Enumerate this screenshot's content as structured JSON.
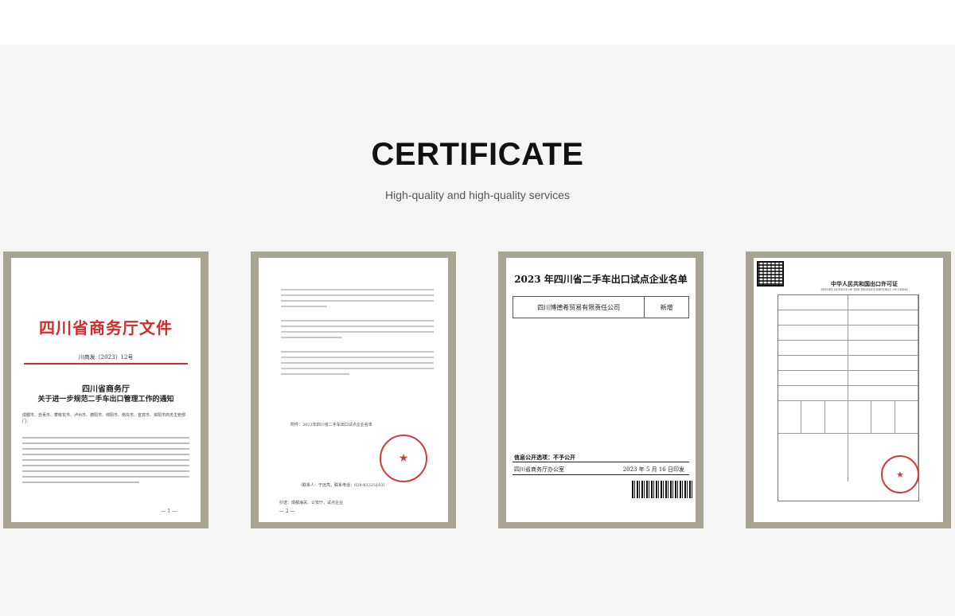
{
  "section": {
    "title": "CERTIFICATE",
    "subtitle": "High-quality and high-quality services"
  },
  "doc1": {
    "header": "四川省商务厅文件",
    "docnum": "川商发〔2023〕12号",
    "org": "四川省商务厅",
    "notice_title": "关于进一步规范二手车出口管理工作的通知",
    "recipients": "成都市、自贡市、攀枝花市、泸州市、德阳市、绵阳市、南充市、宜宾市、资阳市商务主管部门：",
    "page": "— 1 —"
  },
  "doc2": {
    "contact": "（联系人：于远亮，联系电话：028-83225103）",
    "cc": "抄送：成都海关、公安厅，试点企业",
    "attachment": "附件：2023年四川省二手车出口试点企业名单",
    "page": "— 2 —"
  },
  "doc3": {
    "title": "2023 年四川省二手车出口试点企业名单",
    "company": "四川博德希贸易有限责任公司",
    "status": "新增",
    "disclosure": "信息公开选项：不予公开",
    "office": "四川省商务厅办公室",
    "date": "2023 年 5 月 16 日印发"
  },
  "doc4": {
    "title_cn": "中华人民共和国出口许可证",
    "title_en": "EXPORT LICENCE OF THE PEOPLE'S REPUBLIC OF CHINA"
  },
  "colors": {
    "stamp_red": "#d23b3b",
    "frame": "#a8a392",
    "header_red": "#d72a2a"
  }
}
